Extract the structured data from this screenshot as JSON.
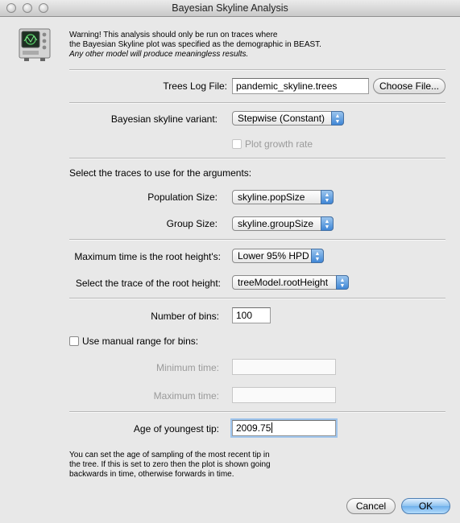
{
  "window": {
    "title": "Bayesian Skyline Analysis"
  },
  "warning": {
    "line1": "Warning! This analysis should only be run on traces where",
    "line2": "the Bayesian Skyline plot was specified as the demographic in BEAST.",
    "line3": "Any other model will produce meaningless results."
  },
  "trees": {
    "label": "Trees Log File:",
    "value": "pandemic_skyline.trees",
    "button": "Choose File..."
  },
  "variant": {
    "label": "Bayesian skyline variant:",
    "selected": "Stepwise (Constant)"
  },
  "growth": {
    "label": "Plot growth rate"
  },
  "traces": {
    "heading": "Select the traces to use for the arguments:",
    "pop_label": "Population Size:",
    "pop_value": "skyline.popSize",
    "group_label": "Group Size:",
    "group_value": "skyline.groupSize"
  },
  "root": {
    "max_label": "Maximum time is the root height's:",
    "max_value": "Lower 95% HPD",
    "trace_label": "Select the trace of the root height:",
    "trace_value": "treeModel.rootHeight"
  },
  "bins": {
    "label": "Number of bins:",
    "value": "100"
  },
  "manual": {
    "label": "Use manual range for bins:",
    "min_label": "Minimum time:",
    "min_value": "",
    "max_label": "Maximum time:",
    "max_value": ""
  },
  "youngest": {
    "label": "Age of youngest tip:",
    "value": "2009.75"
  },
  "note": {
    "line1": "You can set the age of sampling of the most recent tip in",
    "line2": "the tree. If this is set to zero then the plot is shown going",
    "line3": "backwards in time, otherwise forwards in time."
  },
  "buttons": {
    "cancel": "Cancel",
    "ok": "OK"
  },
  "colors": {
    "accent": "#6fb0ec",
    "background": "#e8e8e8"
  },
  "icons": {
    "app": "oscilloscope-icon",
    "popup": "up-down-arrows-icon"
  }
}
